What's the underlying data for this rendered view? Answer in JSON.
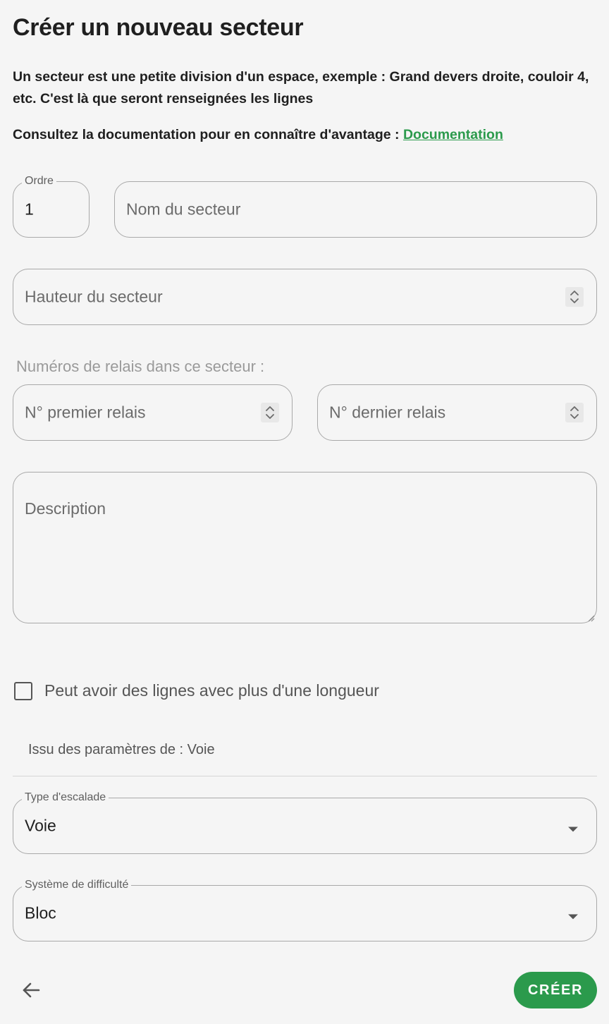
{
  "header": {
    "title": "Créer un nouveau secteur",
    "intro": "Un secteur est une petite division d'un espace, exemple : Grand devers droite, couloir 4, etc. C'est là que seront renseignées les lignes",
    "doc_prefix": "Consultez la documentation pour en connaître d'avantage : ",
    "doc_link": "Documentation"
  },
  "form": {
    "order": {
      "label": "Ordre",
      "value": "1"
    },
    "name": {
      "placeholder": "Nom du secteur"
    },
    "height": {
      "placeholder": "Hauteur du secteur"
    },
    "relays": {
      "section_label": "Numéros de relais dans ce secteur :",
      "first_placeholder": "N° premier relais",
      "last_placeholder": "N° dernier relais"
    },
    "description": {
      "placeholder": "Description"
    },
    "multi_length": {
      "label": "Peut avoir des lignes avec plus d'une longueur",
      "checked": false
    },
    "inherit_text": "Issu des paramètres de : Voie",
    "climb_type": {
      "label": "Type d'escalade",
      "value": "Voie"
    },
    "difficulty_system": {
      "label": "Système de difficulté",
      "value": "Bloc"
    }
  },
  "actions": {
    "back_icon": "arrow-left-icon",
    "create_label": "CRÉER"
  },
  "colors": {
    "accent": "#2b9a4c",
    "background": "#f5f5f5",
    "border": "#a9a9a9"
  }
}
